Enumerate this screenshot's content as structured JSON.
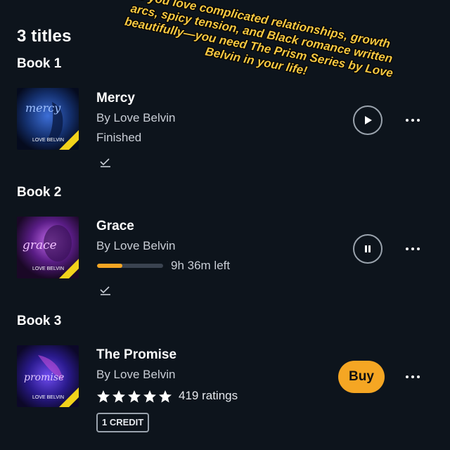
{
  "header": {
    "count_label": "3 titles"
  },
  "overlay": {
    "caption": "If you love complicated relationships, growth arcs, spicy tension, and Black romance written beautifully—you need The Prism Series by Love Belvin in your life!"
  },
  "books": [
    {
      "label": "Book 1",
      "title": "Mercy",
      "author": "By Love Belvin",
      "status": "Finished",
      "action": "play",
      "cover": {
        "script": "mercy",
        "author": "LOVE BELVIN",
        "color": "#1b3f8f"
      }
    },
    {
      "label": "Book 2",
      "title": "Grace",
      "author": "By Love Belvin",
      "time_left": "9h 36m left",
      "progress": 0.38,
      "action": "pause",
      "cover": {
        "script": "grace",
        "author": "LOVE BELVIN",
        "color": "#6b2a8f"
      }
    },
    {
      "label": "Book 3",
      "title": "The Promise",
      "author": "By Love Belvin",
      "rating_stars": 5,
      "ratings": "419 ratings",
      "buy_label": "Buy",
      "credit_label": "1 CREDIT",
      "cover": {
        "script": "promise",
        "author": "LOVE BELVIN",
        "color": "#3a2a9f"
      }
    }
  ],
  "colors": {
    "accent": "#f5a623",
    "background": "#0d141c",
    "overlay_text": "#f7c842"
  }
}
